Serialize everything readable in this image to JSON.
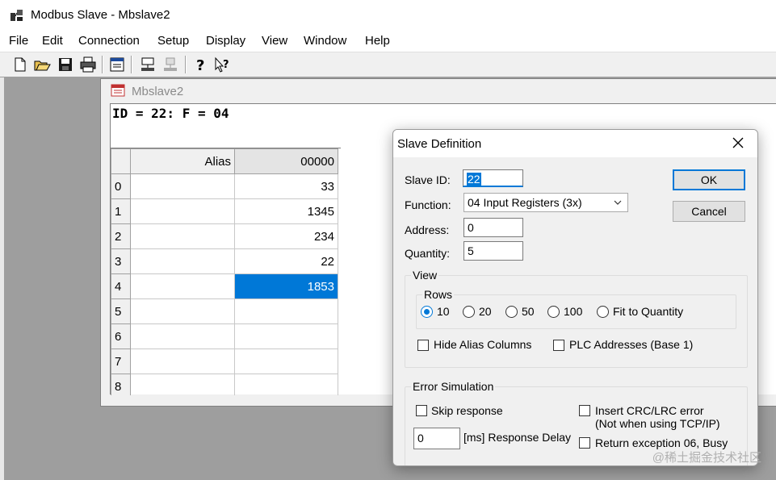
{
  "app": {
    "title": "Modbus Slave - Mbslave2",
    "menu": [
      "File",
      "Edit",
      "Connection",
      "Setup",
      "Display",
      "View",
      "Window",
      "Help"
    ]
  },
  "toolbar": {
    "buttons": [
      "new-icon",
      "open-icon",
      "save-icon",
      "print-icon",
      "window-icon",
      "connect-icon",
      "disconnect-icon",
      "help-icon",
      "context-help-icon"
    ]
  },
  "child": {
    "title": "Mbslave2",
    "status": "ID = 22: F = 04",
    "grid": {
      "headers": {
        "alias": "Alias",
        "value": "00000"
      },
      "rows": [
        {
          "index": "0",
          "alias": "",
          "value": "33"
        },
        {
          "index": "1",
          "alias": "",
          "value": "1345"
        },
        {
          "index": "2",
          "alias": "",
          "value": "234"
        },
        {
          "index": "3",
          "alias": "",
          "value": "22"
        },
        {
          "index": "4",
          "alias": "",
          "value": "1853"
        },
        {
          "index": "5",
          "alias": "",
          "value": ""
        },
        {
          "index": "6",
          "alias": "",
          "value": ""
        },
        {
          "index": "7",
          "alias": "",
          "value": ""
        },
        {
          "index": "8",
          "alias": "",
          "value": ""
        }
      ]
    }
  },
  "dialog": {
    "title": "Slave Definition",
    "slave_id_label": "Slave ID:",
    "slave_id_value": "22",
    "function_label": "Function:",
    "function_value": "04 Input Registers (3x)",
    "address_label": "Address:",
    "address_value": "0",
    "quantity_label": "Quantity:",
    "quantity_value": "5",
    "ok_label": "OK",
    "cancel_label": "Cancel",
    "view_group": "View",
    "rows_group": "Rows",
    "row_options": [
      "10",
      "20",
      "50",
      "100",
      "Fit to Quantity"
    ],
    "row_selected": "10",
    "hide_alias_label": "Hide Alias Columns",
    "plc_addresses_label": "PLC Addresses (Base 1)",
    "error_group": "Error Simulation",
    "skip_response_label": "Skip response",
    "insert_crc_label": "Insert CRC/LRC error",
    "insert_crc_note": "(Not when using TCP/IP)",
    "response_delay_value": "0",
    "response_delay_label": "[ms] Response Delay",
    "return_exception_label": "Return exception 06, Busy"
  },
  "watermark": "@稀土掘金技术社区",
  "colors": {
    "selection": "#0078d7",
    "mdi_background": "#9e9e9e"
  }
}
